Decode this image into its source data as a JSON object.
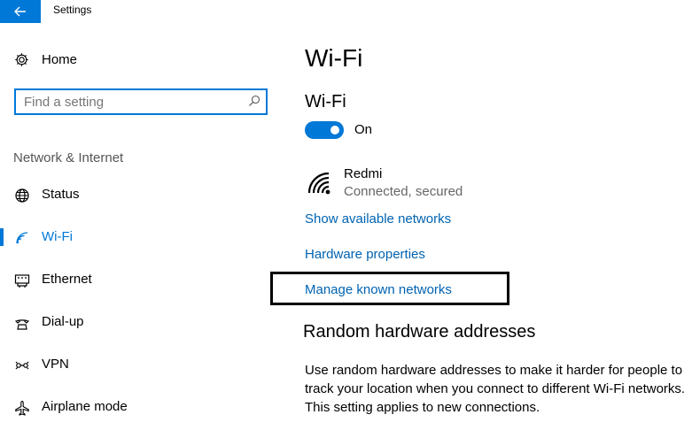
{
  "app": {
    "title": "Settings",
    "back_icon": "back-arrow-icon",
    "accent": "#0078d7"
  },
  "sidebar": {
    "home_label": "Home",
    "search_placeholder": "Find a setting",
    "section_label": "Network & Internet",
    "items": [
      {
        "label": "Status",
        "icon": "globe-icon",
        "active": false
      },
      {
        "label": "Wi-Fi",
        "icon": "wifi-icon",
        "active": true
      },
      {
        "label": "Ethernet",
        "icon": "ethernet-icon",
        "active": false
      },
      {
        "label": "Dial-up",
        "icon": "dialup-icon",
        "active": false
      },
      {
        "label": "VPN",
        "icon": "vpn-icon",
        "active": false
      },
      {
        "label": "Airplane mode",
        "icon": "airplane-icon",
        "active": false
      }
    ]
  },
  "main": {
    "page_title": "Wi-Fi",
    "section_title": "Wi-Fi",
    "toggle_label": "On",
    "toggle_on": true,
    "network": {
      "name": "Redmi",
      "status": "Connected, secured",
      "icon": "wifi-signal-icon"
    },
    "links": {
      "show_available": "Show available networks",
      "hardware_properties": "Hardware properties",
      "manage_known": "Manage known networks"
    },
    "random_hw_title": "Random hardware addresses",
    "random_hw_desc": "Use random hardware addresses to make it harder for people to track your location when you connect to different Wi-Fi networks. This setting applies to new connections."
  }
}
